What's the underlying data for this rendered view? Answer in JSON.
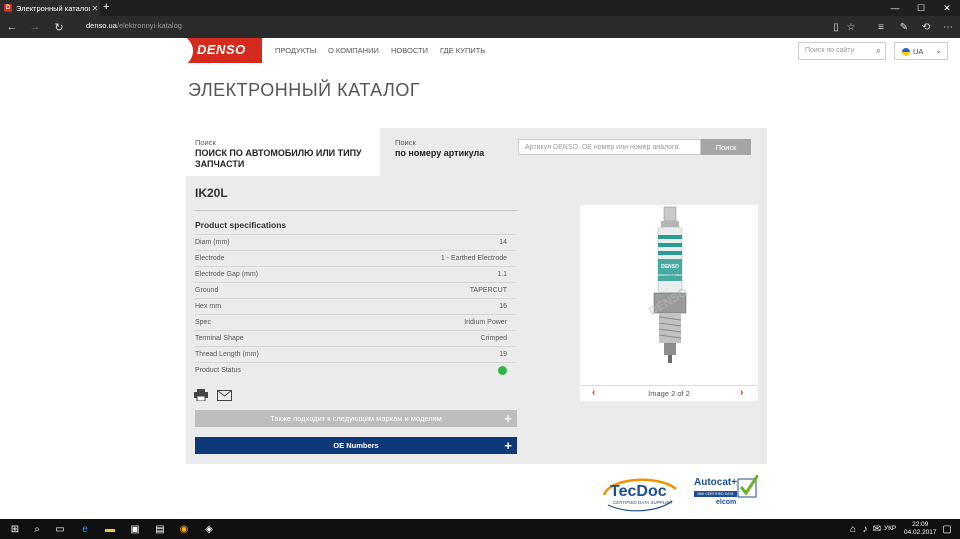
{
  "browser": {
    "tab_title": "Электронный каталог -",
    "tab_icon_letter": "D",
    "url_host": "denso.ua",
    "url_path": "/elektronnyi-katalog"
  },
  "site": {
    "logo_text": "DENSO",
    "nav": [
      "ПРОДУКТЫ",
      "О КОМПАНИИ",
      "НОВОСТИ",
      "ГДЕ КУПИТЬ"
    ],
    "search_placeholder": "Поиск по сайту",
    "language": "UA"
  },
  "page_title": "ЭЛЕКТРОННЫЙ КАТАЛОГ",
  "search_tabs": {
    "auto_small": "Поиск",
    "auto_big": "ПОИСК ПО АВТОМОБИЛЮ ИЛИ ТИПУ ЗАПЧАСТИ",
    "article_small": "Поиск",
    "article_big": "по номеру артикула",
    "article_placeholder": "Артикул DENSO, OE номер или номер аналога",
    "search_button": "Поиск"
  },
  "product": {
    "code": "IK20L",
    "spec_heading": "Product specifications",
    "specs": [
      {
        "label": "Diam (mm)",
        "value": "14"
      },
      {
        "label": "Electrode",
        "value": "1 - Earthed Electrode"
      },
      {
        "label": "Electrode Gap (mm)",
        "value": "1.1"
      },
      {
        "label": "Ground",
        "value": "TAPERCUT"
      },
      {
        "label": "Hex mm",
        "value": "16"
      },
      {
        "label": "Spec",
        "value": "Iridium Power"
      },
      {
        "label": "Terminal Shape",
        "value": "Crimped"
      },
      {
        "label": "Thread Length (mm)",
        "value": "19"
      },
      {
        "label": "Product Status",
        "value": ""
      }
    ],
    "status_color": "#2fb54a",
    "fits_bar": "Также подходит к следующим маркам и моделям",
    "oe_bar": "OE Numbers",
    "image_caption": "Image 2 of 2",
    "plug_text_1": "DENSO",
    "plug_text_2": "IRIDIUM POWER",
    "watermark": "DENSO"
  },
  "footer": {
    "tecdoc": "TecDoc",
    "tecdoc_sub": "CERTIFIED DATA SUPPLIER",
    "autocat": "Autocat+",
    "autocat_sub": "MMI CERTIFIED DATA",
    "elcom": "elcom"
  },
  "taskbar": {
    "lang": "УКР",
    "time": "22:09",
    "date": "04.02.2017"
  },
  "colors": {
    "brand_red": "#d52b1e",
    "oe_blue": "#0e3978",
    "fits_gray": "#bdbdbd"
  }
}
